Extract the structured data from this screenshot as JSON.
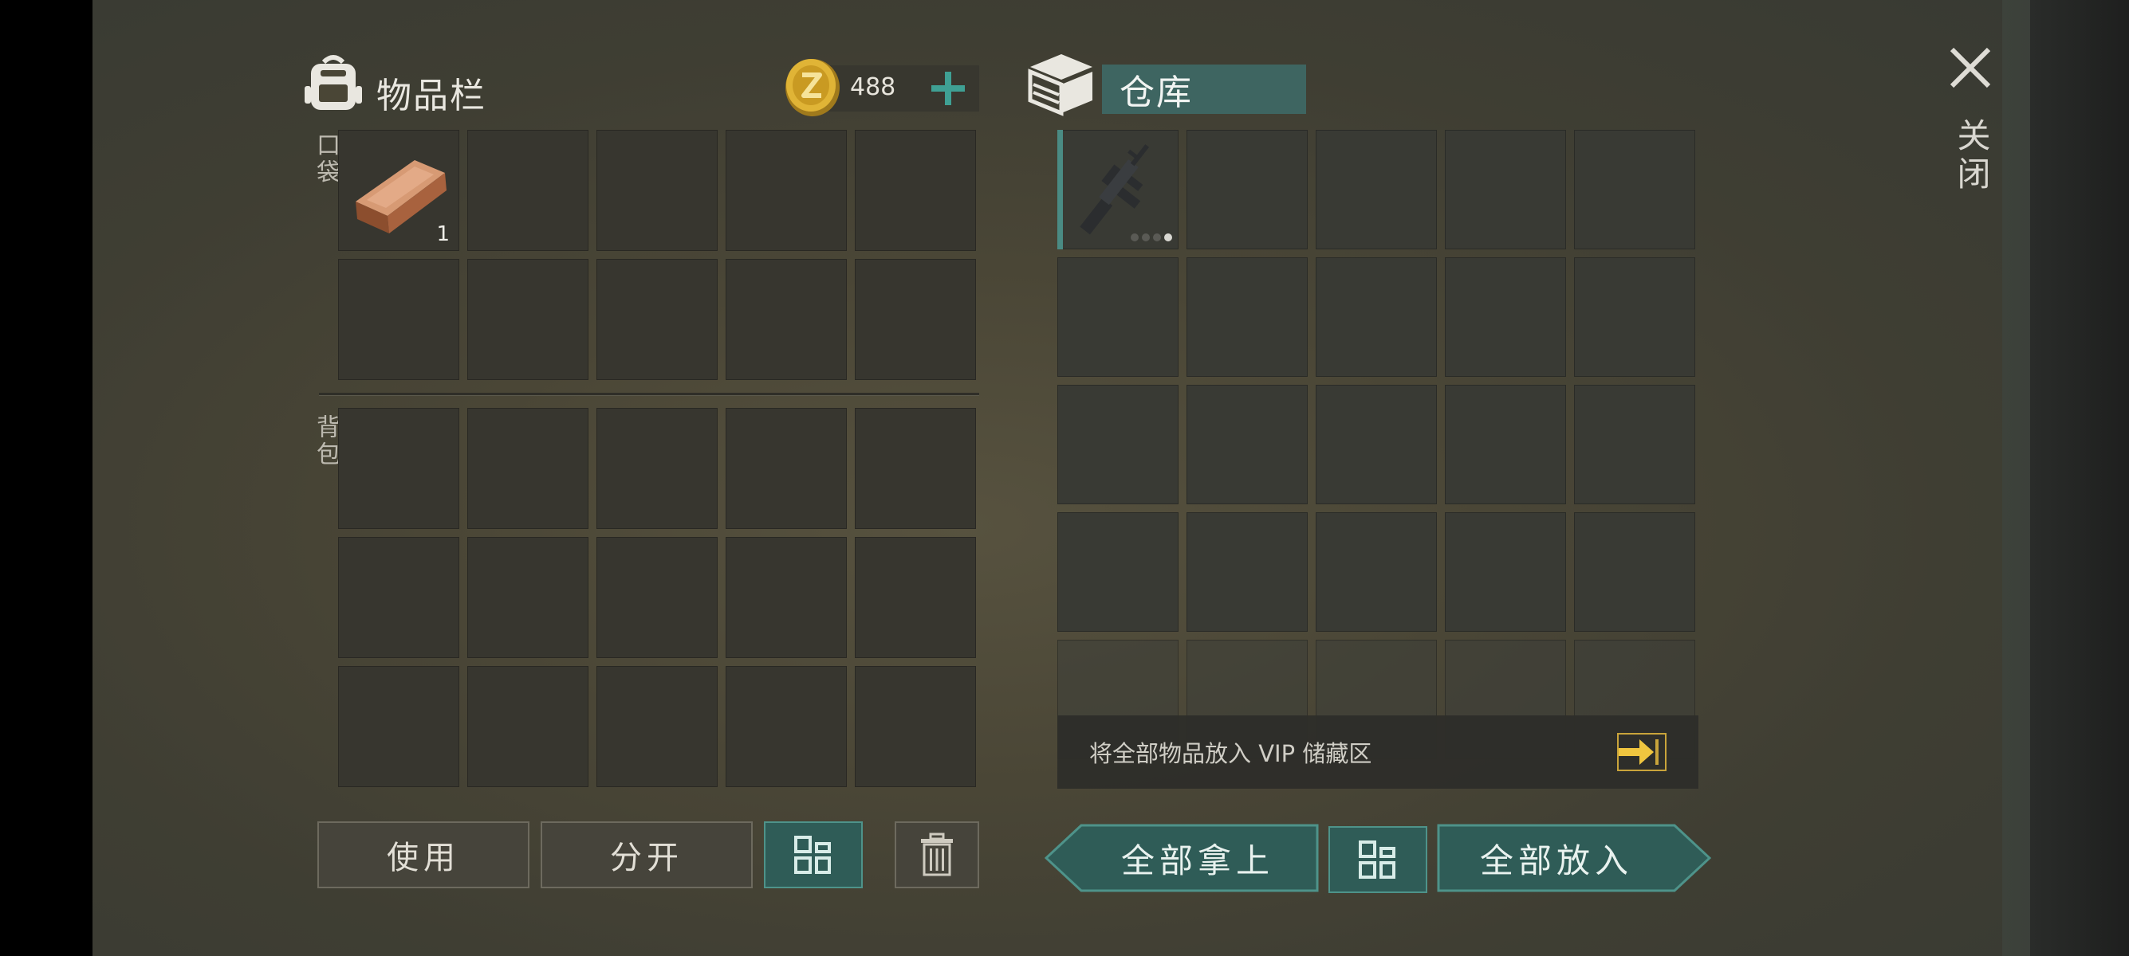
{
  "inventory": {
    "title": "物品栏",
    "coins": "488",
    "pocket_label": "口袋",
    "backpack_label": "背包",
    "pocket_slots": [
      {
        "item": "copper-ingot",
        "qty": "1"
      },
      {},
      {},
      {},
      {},
      {},
      {},
      {},
      {},
      {}
    ],
    "backpack_slots": [
      {},
      {},
      {},
      {},
      {},
      {},
      {},
      {},
      {},
      {},
      {},
      {},
      {},
      {},
      {}
    ]
  },
  "warehouse": {
    "title": "仓库",
    "first_item": "assault-rifle",
    "rifle_dots_total": 4,
    "rifle_dots_filled": 1,
    "vip_text": "将全部物品放入 VIP 储藏区"
  },
  "buttons": {
    "use": "使用",
    "split": "分开",
    "take_all": "全部拿上",
    "put_all": "全部放入"
  },
  "close_label": "关闭",
  "colors": {
    "accent_teal": "#2f5c57",
    "slot_dark": "#37362f",
    "gold": "#c9a43b"
  }
}
